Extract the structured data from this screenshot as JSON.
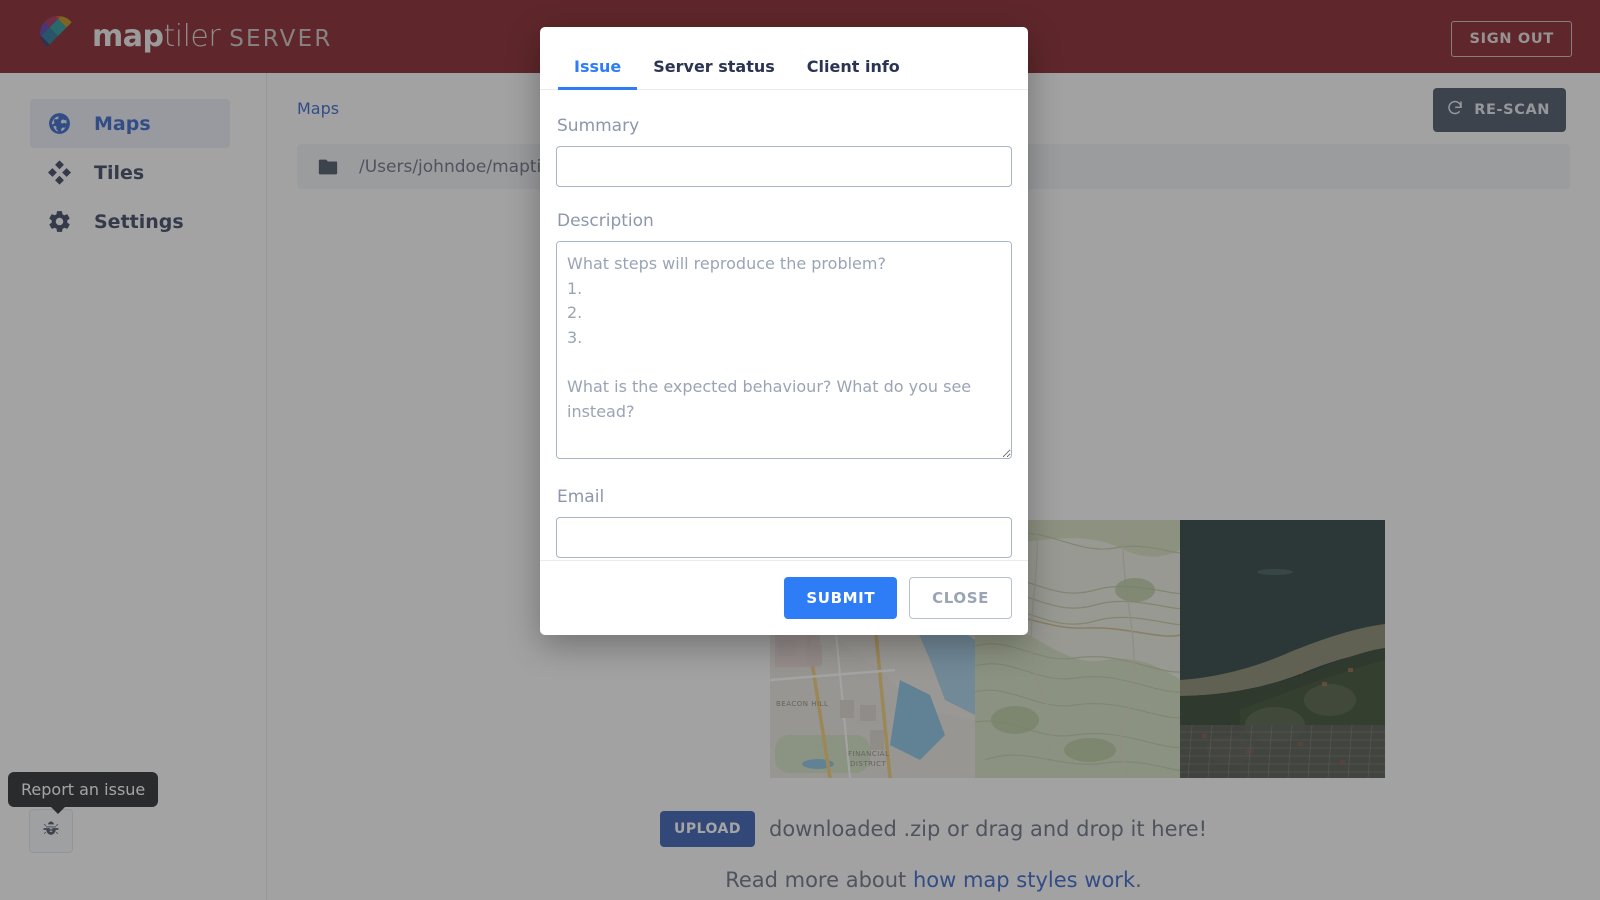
{
  "header": {
    "logo": {
      "brand_bold": "map",
      "brand_light": "tiler",
      "product": "SERVER",
      "icon": "maptiler-pin-logo"
    },
    "sign_out_label": "SIGN OUT",
    "background_color": "#7b1118"
  },
  "sidebar": {
    "items": [
      {
        "label": "Maps",
        "icon": "globe-icon",
        "active": true
      },
      {
        "label": "Tiles",
        "icon": "tiles-diamond-icon",
        "active": false
      },
      {
        "label": "Settings",
        "icon": "gear-icon",
        "active": false
      }
    ]
  },
  "content": {
    "breadcrumb": "Maps",
    "rescan_label": "RE-SCAN",
    "rescan_icon": "refresh-icon",
    "folder_icon": "folder-icon",
    "folder_path": "/Users/johndoe/maptiler-se",
    "upload_button_label": "UPLOAD",
    "upload_text": "downloaded .zip or drag and drop it here!",
    "readmore_prefix": "Read more about ",
    "readmore_link": "how map styles work",
    "readmore_suffix": ".",
    "thumbnails": [
      {
        "name": "street-map-thumbnail",
        "labels": [
          "BEACON HILL",
          "FINANCIAL DISTRICT"
        ]
      },
      {
        "name": "topo-map-thumbnail",
        "labels": []
      },
      {
        "name": "satellite-map-thumbnail",
        "labels": []
      }
    ]
  },
  "issue_fab": {
    "tooltip": "Report an issue",
    "icon": "bug-icon"
  },
  "modal": {
    "tabs": [
      {
        "label": "Issue",
        "active": true
      },
      {
        "label": "Server status",
        "active": false
      },
      {
        "label": "Client info",
        "active": false
      }
    ],
    "summary": {
      "label": "Summary",
      "value": "",
      "placeholder": ""
    },
    "description": {
      "label": "Description",
      "value": "",
      "placeholder": "What steps will reproduce the problem?\n1.\n2.\n3.\n\nWhat is the expected behaviour? What do you see instead?\n\n\nPlease provide any additional information below."
    },
    "email": {
      "label": "Email",
      "value": "",
      "placeholder": ""
    },
    "submit_label": "SUBMIT",
    "close_label": "CLOSE",
    "accent_color": "#2e7df7"
  }
}
